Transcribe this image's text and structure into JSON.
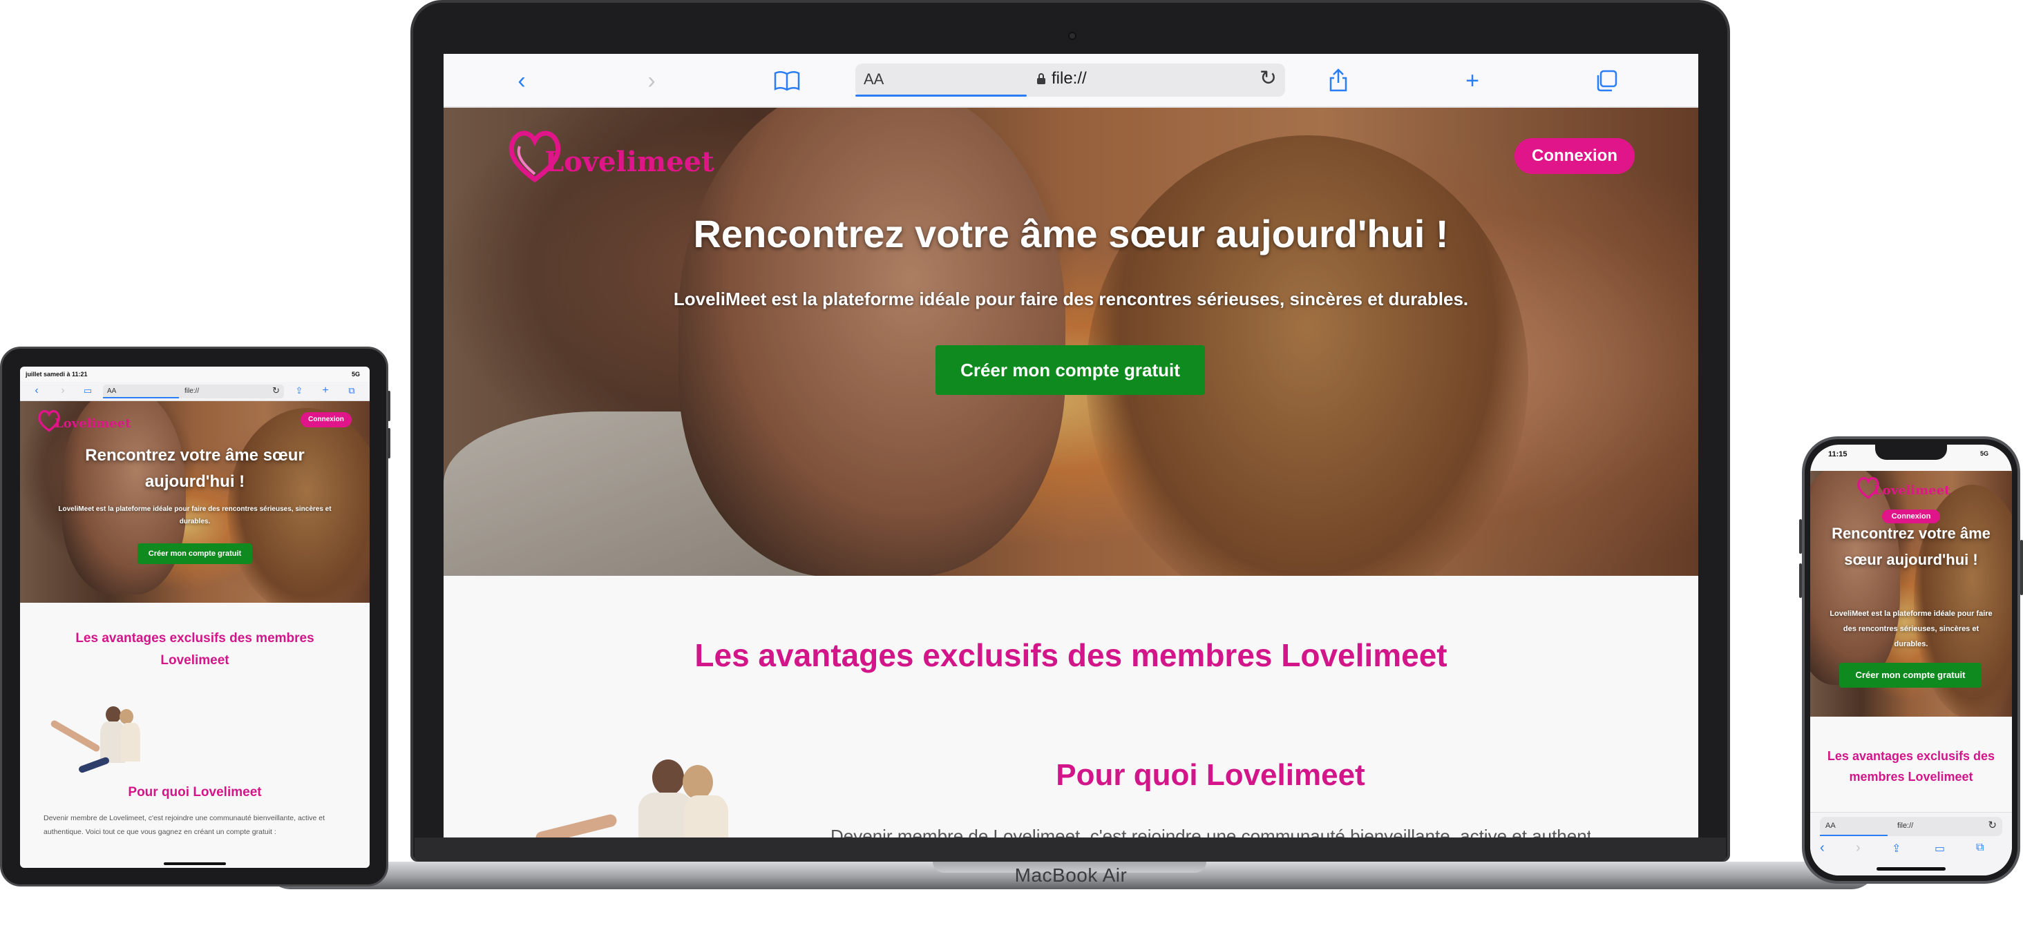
{
  "brand": {
    "logo_text": "Lovelimeet",
    "logo_letter": "L",
    "pink": "#e0158a",
    "green": "#0f8a1e"
  },
  "hero": {
    "title": "Rencontrez votre âme sœur aujourd'hui !",
    "subtitle": "LoveliMeet est la plateforme idéale pour faire des rencontres sérieuses, sincères et durables.",
    "cta": "Créer mon compte gratuit",
    "login": "Connexion"
  },
  "sections": {
    "advantages_title": "Les avantages exclusifs des membres Lovelimeet",
    "why_title": "Pour quoi Lovelimeet",
    "why_text": "Devenir membre de Lovelimeet, c'est rejoindre une communauté bienveillante, active et authentique. Voici tout ce que vous gagnez en créant un compte gratuit :"
  },
  "laptop": {
    "model_label": "MacBook Air",
    "browser": {
      "address": "file://",
      "text_size": "AA"
    }
  },
  "tablet": {
    "status_time": "juillet samedi à 11:21",
    "status_right": "5G",
    "address": "file://",
    "text_size": "AA"
  },
  "phone": {
    "status_time": "11:15",
    "status_right": "5G",
    "address": "file://",
    "text_size": "AA"
  },
  "icons": {
    "back": "chevron-left-icon",
    "forward": "chevron-right-icon",
    "bookmarks": "book-icon",
    "reload": "reload-icon",
    "share": "share-icon",
    "new_tab": "plus-icon",
    "tabs": "tabs-icon",
    "lock": "lock-icon"
  }
}
